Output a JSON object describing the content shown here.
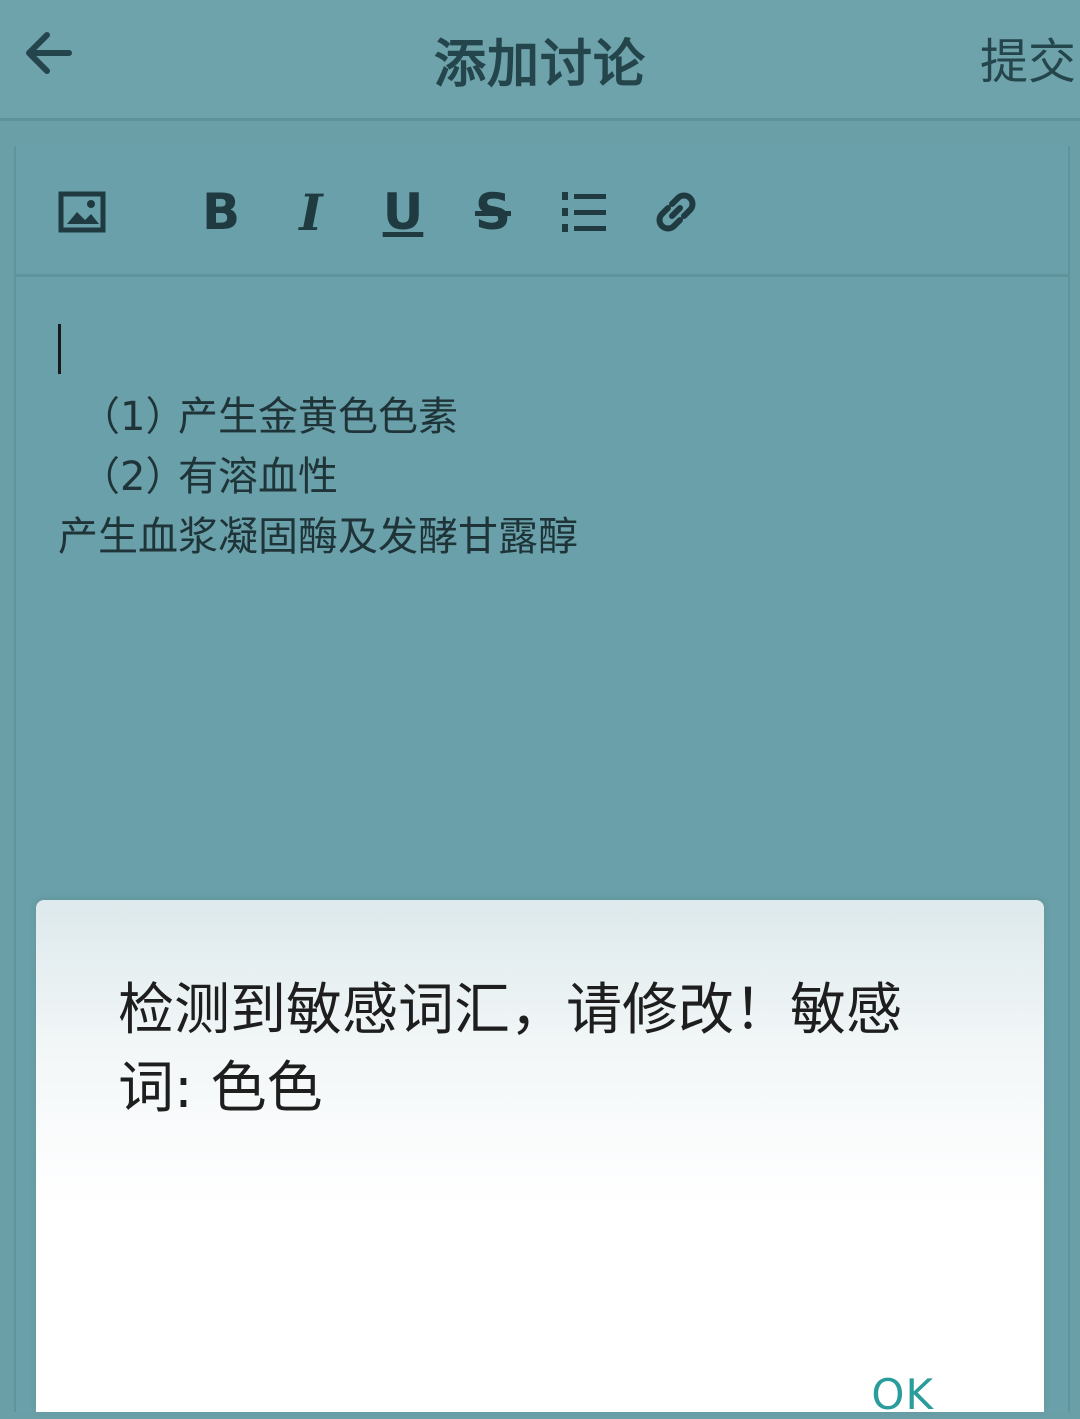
{
  "header": {
    "back_icon": "arrow-left-icon",
    "title": "添加讨论",
    "submit_label": "提交"
  },
  "toolbar": {
    "image_icon": "image-icon",
    "bold": "B",
    "italic": "I",
    "underline": "U",
    "strikethrough": "S",
    "list_icon": "numbered-list-icon",
    "link_icon": "link-icon"
  },
  "editor": {
    "lines": [
      {
        "num": "（1）",
        "text": "产生金黄色色素"
      },
      {
        "num": "（2）",
        "text": "有溶血性"
      },
      {
        "num": "",
        "text": "产生血浆凝固酶及发酵甘露醇"
      }
    ]
  },
  "dialog": {
    "message": "检测到敏感词汇，请修改！敏感词: 色色",
    "ok_label": "OK"
  },
  "colors": {
    "background": "#6a9fa8",
    "ok_accent": "#2a9c9c"
  }
}
